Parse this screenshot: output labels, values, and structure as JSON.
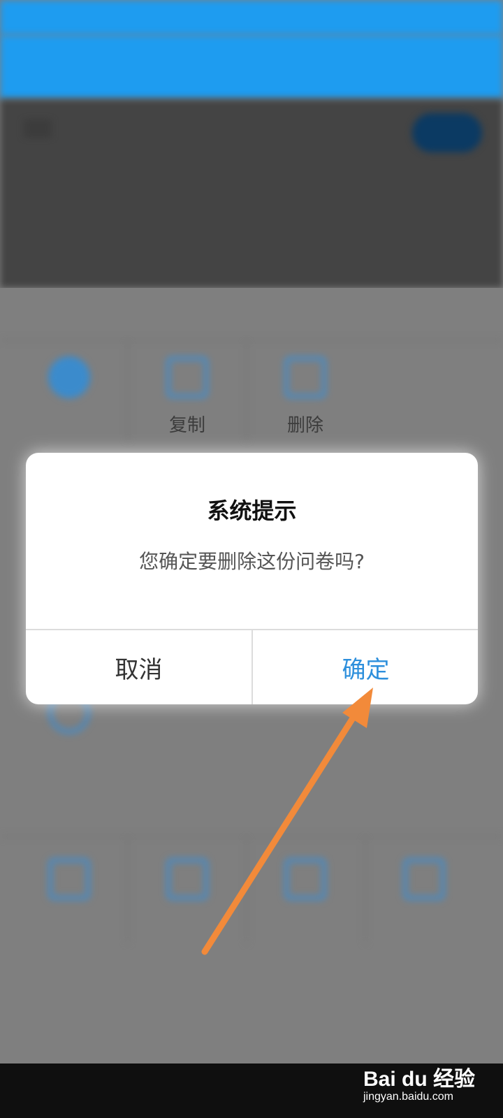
{
  "background_app": {
    "grid_labels": [
      "复制",
      "删除"
    ]
  },
  "dialog": {
    "title": "系统提示",
    "message": "您确定要删除这份问卷吗?",
    "cancel_label": "取消",
    "confirm_label": "确定"
  },
  "watermark": {
    "brand": "Bai du 经验",
    "url": "jingyan.baidu.com"
  },
  "colors": {
    "accent": "#1e9cf0",
    "confirm": "#2d8fdc",
    "arrow": "#f28a3a"
  }
}
